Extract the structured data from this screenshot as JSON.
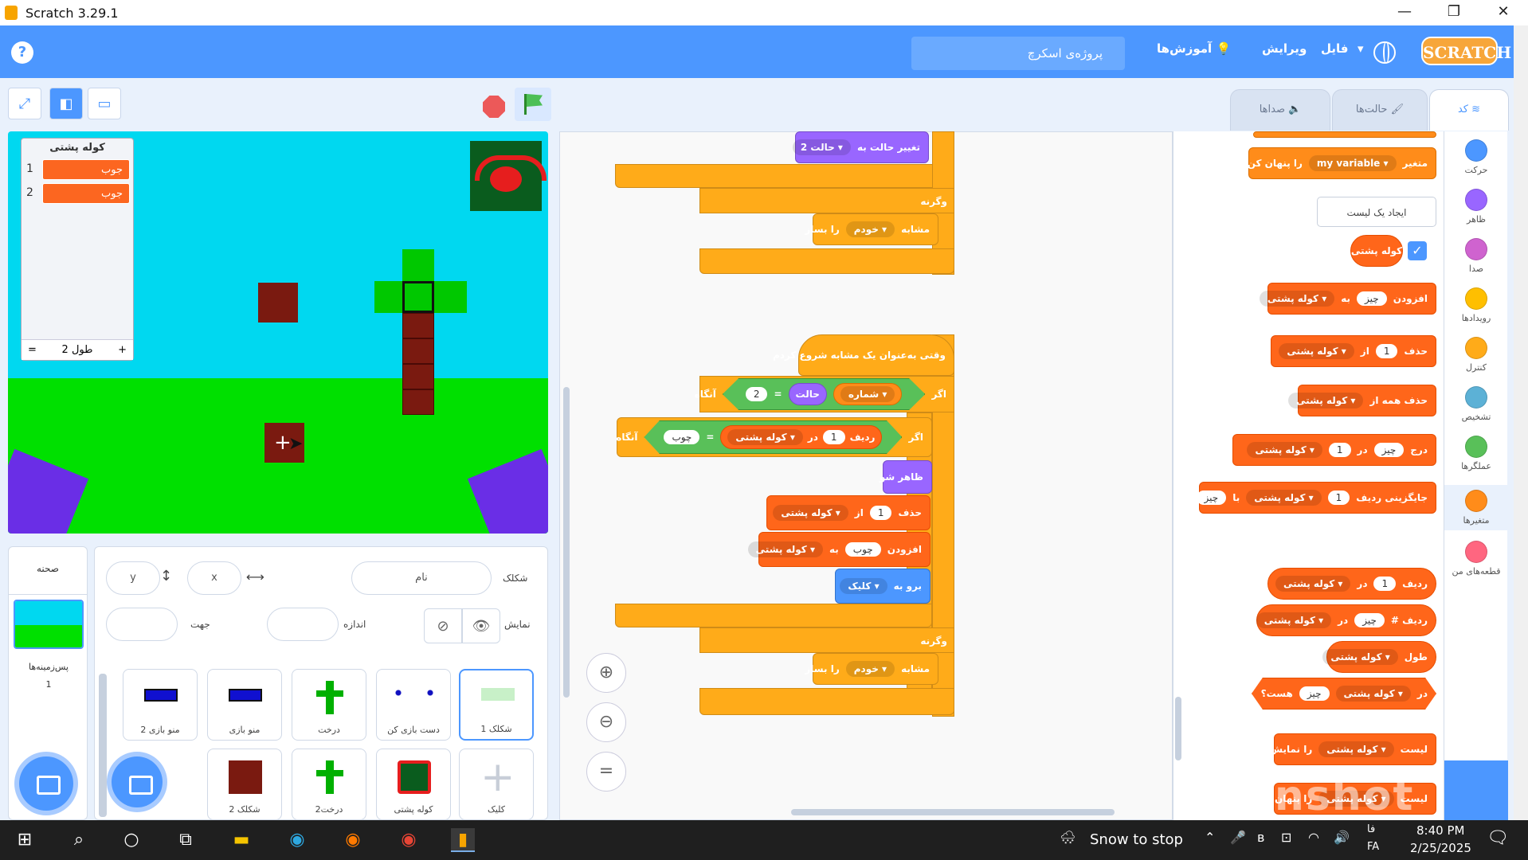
{
  "window": {
    "title": "Scratch 3.29.1",
    "min": "—",
    "restore": "❐",
    "close": "✕"
  },
  "menu": {
    "help": "?",
    "project_title": "پروژه‌ی اسکرچ",
    "tutorials": "آموزش‌ها",
    "edit": "ویرایش",
    "file": "فایل",
    "logo": "SCRATCH"
  },
  "list_monitor": {
    "title": "کوله پشتی",
    "items": [
      "جوب",
      "جوب"
    ],
    "indexes": [
      "1",
      "2"
    ],
    "length_label": "طول 2",
    "add": "+",
    "eq": "="
  },
  "tabs": {
    "code": "کد",
    "costumes": "حالت‌ها",
    "sounds": "صداها"
  },
  "categories": [
    {
      "label": "حرکت",
      "color": "#4c97ff"
    },
    {
      "label": "ظاهر",
      "color": "#9966ff"
    },
    {
      "label": "صدا",
      "color": "#cf63cf"
    },
    {
      "label": "رویدادها",
      "color": "#ffbf00"
    },
    {
      "label": "کنترل",
      "color": "#ffab19"
    },
    {
      "label": "تشخیص",
      "color": "#5cb1d6"
    },
    {
      "label": "عملگرها",
      "color": "#59c059"
    },
    {
      "label": "متغیرها",
      "color": "#ff8c1a"
    },
    {
      "label": "قطعه‌های من",
      "color": "#ff6680"
    }
  ],
  "palette": {
    "var_show": {
      "a": "متغیر",
      "b": "my variable",
      "c": "را پنهان کن"
    },
    "make_list": "ایجاد یک لیست",
    "list_name": "کوله پشتی",
    "add": {
      "a": "افزودن",
      "b": "چیز",
      "c": "به",
      "d": "کوله پشتی"
    },
    "delete": {
      "a": "حذف",
      "b": "1",
      "c": "از",
      "d": "کوله پشتی"
    },
    "delete_all": {
      "a": "حذف همه از",
      "b": "کوله پشتی"
    },
    "insert": {
      "a": "درج",
      "b": "چیز",
      "c": "در",
      "d": "1",
      "e": "کوله پشتی"
    },
    "replace": {
      "a": "جایگزینی ردیف",
      "b": "1",
      "c": "کوله پشتی",
      "d": "با",
      "e": "چیز"
    },
    "item": {
      "a": "ردیف",
      "b": "1",
      "c": "در",
      "d": "کوله پشتی"
    },
    "item_num": {
      "a": "# ردیف",
      "b": "چیز",
      "c": "در",
      "d": "کوله پشتی"
    },
    "length": {
      "a": "طول",
      "b": "کوله پشتی"
    },
    "contains": {
      "a": "در",
      "b": "کوله پشتی",
      "c": "چیز",
      "d": "هست؟"
    },
    "show_list": {
      "a": "لیست",
      "b": "کوله پشتی",
      "c": "را نمایش بده"
    },
    "hide_list": {
      "a": "لیست",
      "b": "کوله پشتی",
      "c": "را پنهان کن"
    }
  },
  "script1": {
    "switch": {
      "a": "تغییر حالت به",
      "b": "حالت 2"
    },
    "else": "وگرنه",
    "make_clone": {
      "a": "مشابه",
      "b": "خودم",
      "c": "را بساز"
    }
  },
  "script2": {
    "hat": "وقتی به‌عنوان یک مشابه شروع کردم",
    "if1": {
      "a": "اگر",
      "b": "شماره",
      "c": "حالت",
      "d": "=",
      "e": "2",
      "f": "آنگاه"
    },
    "if2": {
      "a": "اگر",
      "b": "ردیف",
      "c": "1",
      "d": "در",
      "e": "کوله پشتی",
      "f": "=",
      "g": "چوب",
      "h": "آنگاه"
    },
    "show": "ظاهر شو",
    "delete": {
      "a": "حذف",
      "b": "1",
      "c": "از",
      "d": "کوله پشتی"
    },
    "add": {
      "a": "افزودن",
      "b": "چوب",
      "c": "به",
      "d": "کوله پشتی"
    },
    "goto": {
      "a": "برو به",
      "b": "کلیک"
    },
    "else": "وگرنه",
    "make_clone": {
      "a": "مشابه",
      "b": "خودم",
      "c": "را بساز"
    }
  },
  "sprite_info": {
    "sprite_label": "شکلک",
    "name_placeholder": "نام",
    "x_label": "x",
    "x_value": "x",
    "y_label": "y",
    "y_value": "y",
    "show_label": "نمایش",
    "size_label": "اندازه",
    "dir_label": "جهت"
  },
  "stage_pane": {
    "title": "صحنه",
    "backdrops_label": "پس‌زمینه‌ها",
    "backdrops_count": "1"
  },
  "sprites": [
    {
      "name": "شکلک 1",
      "color": "#c8f0c8"
    },
    {
      "name": "دست بازی کن",
      "color": "#1010c0"
    },
    {
      "name": "درخت",
      "color": "#00b000"
    },
    {
      "name": "منو بازی",
      "color": "#1010d0"
    },
    {
      "name": "منو بازی 2",
      "color": "#1010d0"
    },
    {
      "name": "کلیک",
      "color": "#dde3ec"
    },
    {
      "name": "کوله پشتی",
      "color": "#0a5c1e"
    },
    {
      "name": "درخت2",
      "color": "#00b000"
    },
    {
      "name": "شکلک 2",
      "color": "#7a1a10"
    }
  ],
  "taskbar": {
    "weather": "Snow to stop",
    "lang1": "فا",
    "lang2": "FA",
    "time": "8:40 PM",
    "date": "2/25/2025"
  },
  "watermark": "inshot"
}
